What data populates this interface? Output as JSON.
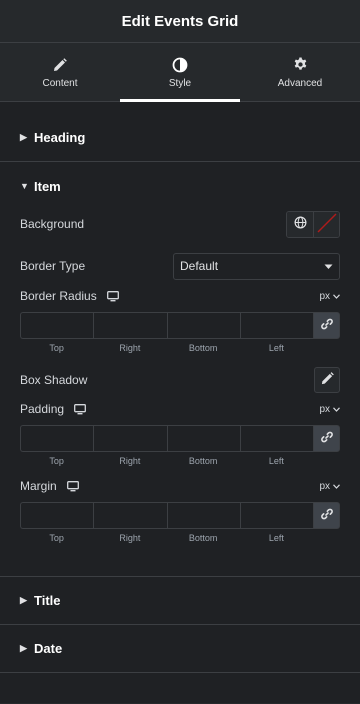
{
  "header": {
    "title": "Edit Events Grid"
  },
  "tabs": [
    {
      "label": "Content",
      "icon": "pencil-icon"
    },
    {
      "label": "Style",
      "icon": "contrast-icon",
      "active": true
    },
    {
      "label": "Advanced",
      "icon": "gear-icon"
    }
  ],
  "sections": {
    "heading": "Heading",
    "item": "Item",
    "title": "Title",
    "date": "Date"
  },
  "item": {
    "background_label": "Background",
    "border_type_label": "Border Type",
    "border_type_value": "Default",
    "border_radius_label": "Border Radius",
    "box_shadow_label": "Box Shadow",
    "padding_label": "Padding",
    "margin_label": "Margin",
    "unit": "px",
    "dim_labels": {
      "top": "Top",
      "right": "Right",
      "bottom": "Bottom",
      "left": "Left"
    }
  },
  "colors": {
    "panel": "#26292c",
    "body": "#1f2124",
    "border": "#3c3f43",
    "text": "#e0e1e3",
    "muted": "#9da5ae",
    "danger": "#b01b1b"
  }
}
